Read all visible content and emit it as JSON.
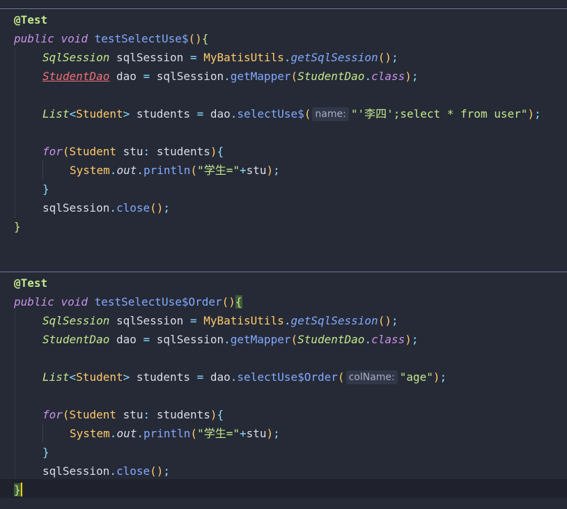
{
  "theme": {
    "background": "#262a36",
    "annotation": "#c3e88d",
    "keyword": "#c792ea",
    "method": "#82aaff",
    "type": "#ffcb6b",
    "string": "#c3e88d",
    "error": "#f07178"
  },
  "block1": {
    "annotation": "@Test",
    "kw_public": "public",
    "kw_void": "void",
    "method_name": "testSelectUse$",
    "l1_type": "SqlSession",
    "l1_var": "sqlSession",
    "l1_class": "MyBatisUtils",
    "l1_call": "getSqlSession",
    "l2_type": "StudentDao",
    "l2_var": "dao",
    "l2_recv": "sqlSession",
    "l2_call": "getMapper",
    "l2_argtype": "StudentDao",
    "l2_kwclass": "class",
    "l3_list": "List",
    "l3_generic": "Student",
    "l3_var": "students",
    "l3_recv": "dao",
    "l3_call": "selectUse$",
    "l3_hint": "name:",
    "l3_arg": "\"'李四';select * from user\"",
    "for_kw": "for",
    "for_type": "Student",
    "for_var": "stu",
    "for_iter": "students",
    "print_cls": "System",
    "print_field": "out",
    "print_call": "println",
    "print_str": "\"学生=\"",
    "print_arg": "stu",
    "close_recv": "sqlSession",
    "close_call": "close"
  },
  "block2": {
    "annotation": "@Test",
    "kw_public": "public",
    "kw_void": "void",
    "method_name": "testSelectUse$Order",
    "l1_type": "SqlSession",
    "l1_var": "sqlSession",
    "l1_class": "MyBatisUtils",
    "l1_call": "getSqlSession",
    "l2_type": "StudentDao",
    "l2_var": "dao",
    "l2_recv": "sqlSession",
    "l2_call": "getMapper",
    "l2_argtype": "StudentDao",
    "l2_kwclass": "class",
    "l3_list": "List",
    "l3_generic": "Student",
    "l3_var": "students",
    "l3_recv": "dao",
    "l3_call": "selectUse$Order",
    "l3_hint": "colName:",
    "l3_arg": "\"age\"",
    "for_kw": "for",
    "for_type": "Student",
    "for_var": "stu",
    "for_iter": "students",
    "print_cls": "System",
    "print_field": "out",
    "print_call": "println",
    "print_str": "\"学生=\"",
    "print_arg": "stu",
    "close_recv": "sqlSession",
    "close_call": "close"
  }
}
